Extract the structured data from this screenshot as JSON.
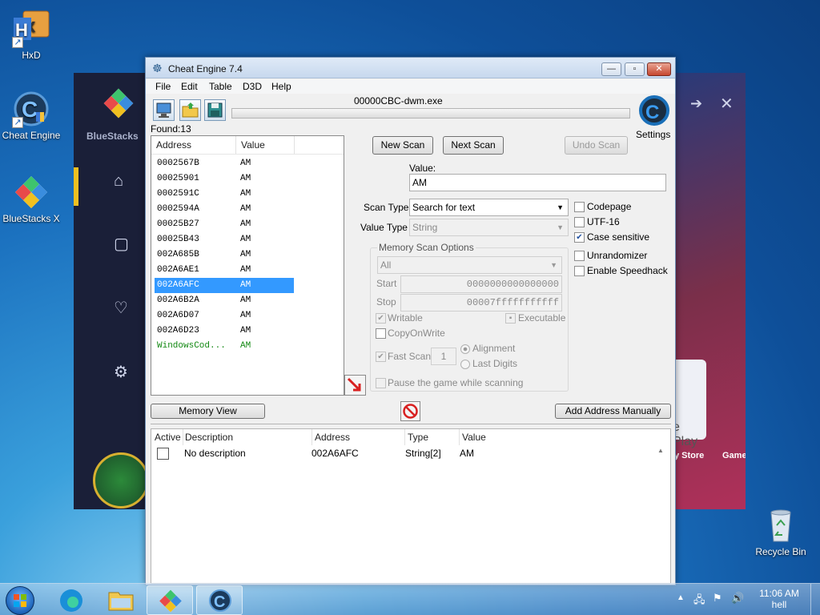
{
  "desktop": {
    "icons": [
      {
        "label": "HxD",
        "icon": "hxd-icon"
      },
      {
        "label": "Cheat Engine",
        "icon": "cheat-engine-icon"
      },
      {
        "label": "BlueStacks X",
        "icon": "bluestacks-icon"
      },
      {
        "label": "Recycle Bin",
        "icon": "recycle-bin-icon"
      }
    ]
  },
  "bluestacks": {
    "brand": "BlueStacks",
    "store_label": "y Store",
    "games_label": "Game",
    "play_label": "e Play"
  },
  "window": {
    "title": "Cheat Engine 7.4",
    "menu": [
      "File",
      "Edit",
      "Table",
      "D3D",
      "Help"
    ],
    "process": "00000CBC-dwm.exe",
    "found": "Found:13",
    "settings_label": "Settings"
  },
  "results": {
    "columns": [
      "Address",
      "Value"
    ],
    "rows": [
      {
        "address": "0002567B",
        "value": "AM"
      },
      {
        "address": "00025901",
        "value": "AM"
      },
      {
        "address": "0002591C",
        "value": "AM"
      },
      {
        "address": "0002594A",
        "value": "AM"
      },
      {
        "address": "00025B27",
        "value": "AM"
      },
      {
        "address": "00025B43",
        "value": "AM"
      },
      {
        "address": "002A685B",
        "value": "AM"
      },
      {
        "address": "002A6AE1",
        "value": "AM"
      },
      {
        "address": "002A6AFC",
        "value": "AM"
      },
      {
        "address": "002A6B2A",
        "value": "AM"
      },
      {
        "address": "002A6D07",
        "value": "AM"
      },
      {
        "address": "002A6D23",
        "value": "AM"
      },
      {
        "address": "WindowsCod...",
        "value": "AM"
      }
    ]
  },
  "scan": {
    "new_scan": "New Scan",
    "next_scan": "Next Scan",
    "undo_scan": "Undo Scan",
    "value_label": "Value:",
    "value": "AM",
    "scan_type_label": "Scan Type",
    "scan_type": "Search for text",
    "value_type_label": "Value Type",
    "value_type": "String",
    "memory_options_title": "Memory Scan Options",
    "region": "All",
    "start_label": "Start",
    "start": "0000000000000000",
    "stop_label": "Stop",
    "stop": "00007fffffffffff",
    "writable": "Writable",
    "executable": "Executable",
    "copy_on_write": "CopyOnWrite",
    "fast_scan": "Fast Scan",
    "fast_scan_value": "1",
    "alignment": "Alignment",
    "last_digits": "Last Digits",
    "pause_game": "Pause the game while scanning",
    "codepage": "Codepage",
    "utf16": "UTF-16",
    "case_sensitive": "Case sensitive",
    "unrandomizer": "Unrandomizer",
    "enable_speedhack": "Enable Speedhack"
  },
  "bottom": {
    "memory_view": "Memory View",
    "add_address": "Add Address Manually"
  },
  "table": {
    "columns": [
      "Active",
      "Description",
      "Address",
      "Type",
      "Value"
    ],
    "rows": [
      {
        "description": "No description",
        "address": "002A6AFC",
        "type": "String[2]",
        "value": "AM"
      }
    ]
  },
  "taskbar": {
    "time": "11:06 AM",
    "user": "hell"
  },
  "colors": {
    "selection": "#3399ff",
    "green_entry": "#118811",
    "title_bar": "#c7d8ee",
    "close_button": "#c6462e"
  }
}
